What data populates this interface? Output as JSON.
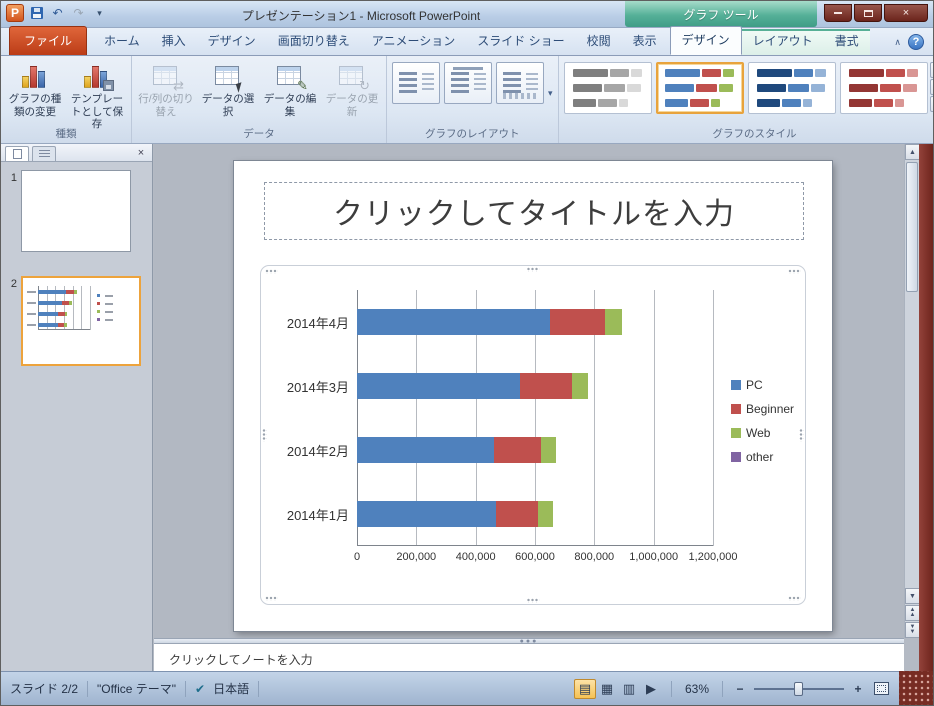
{
  "titlebar": {
    "title": "プレゼンテーション1 - Microsoft PowerPoint",
    "context_group": "グラフ ツール"
  },
  "icons": {
    "undo": "↶",
    "redo": "↷",
    "dropdown": "▾",
    "close": "×",
    "help": "?",
    "collapse": "∧",
    "scroll_up": "▲",
    "scroll_down": "▼",
    "panel_close": "×",
    "check": "✔",
    "switch": "⇄",
    "edit": "✎",
    "refresh": "↻",
    "view_normal": "▤",
    "view_sorter": "▦",
    "view_reading": "▥",
    "view_slideshow": "▶",
    "zoom_minus": "−",
    "zoom_plus": "+",
    "splitter_dots": "●●●"
  },
  "ribbon": {
    "file_tab": "ファイル",
    "tabs": [
      "ホーム",
      "挿入",
      "デザイン",
      "画面切り替え",
      "アニメーション",
      "スライド ショー",
      "校閲",
      "表示"
    ],
    "context_tabs": [
      "デザイン",
      "レイアウト",
      "書式"
    ],
    "groups": {
      "type": {
        "label": "種類",
        "buttons": [
          {
            "label": "グラフの種類の変更"
          },
          {
            "label": "テンプレートとして保存"
          }
        ]
      },
      "data": {
        "label": "データ",
        "buttons": [
          {
            "label": "行/列の切り替え",
            "disabled": true
          },
          {
            "label": "データの選択"
          },
          {
            "label": "データの編集"
          },
          {
            "label": "データの更新",
            "disabled": true
          }
        ]
      },
      "layouts": {
        "label": "グラフのレイアウト"
      },
      "styles": {
        "label": "グラフのスタイル",
        "gallery": [
          {
            "name": "style-gray",
            "colors": [
              "#7f7f7f",
              "#a6a6a6",
              "#d9d9d9"
            ]
          },
          {
            "name": "style-multicolor",
            "colors": [
              "#4f81bd",
              "#c0504d",
              "#9bbb59"
            ],
            "selected": true
          },
          {
            "name": "style-blue",
            "colors": [
              "#1f497d",
              "#4f81bd",
              "#95b3d7"
            ]
          },
          {
            "name": "style-red",
            "colors": [
              "#943634",
              "#c0504d",
              "#d99694"
            ]
          }
        ]
      }
    }
  },
  "slides_panel": {
    "slides": [
      {
        "number": "1"
      },
      {
        "number": "2",
        "selected": true
      }
    ]
  },
  "slide": {
    "title_placeholder": "クリックしてタイトルを入力"
  },
  "notes": {
    "placeholder": "クリックしてノートを入力"
  },
  "statusbar": {
    "slide_indicator": "スライド 2/2",
    "theme_name": "\"Office テーマ\"",
    "language": "日本語",
    "zoom_level": "63%"
  },
  "chart_data": {
    "type": "bar",
    "orientation": "horizontal",
    "stacked": true,
    "categories": [
      "2014年4月",
      "2014年3月",
      "2014年2月",
      "2014年1月"
    ],
    "series": [
      {
        "name": "PC",
        "color": "#4f81bd",
        "values": [
          650000,
          550000,
          460000,
          470000
        ]
      },
      {
        "name": "Beginner",
        "color": "#c0504d",
        "values": [
          185000,
          175000,
          160000,
          140000
        ]
      },
      {
        "name": "Web",
        "color": "#9bbb59",
        "values": [
          60000,
          55000,
          50000,
          50000
        ]
      },
      {
        "name": "other",
        "color": "#8064a2",
        "values": [
          0,
          0,
          0,
          0
        ]
      }
    ],
    "xlim": [
      0,
      1200000
    ],
    "xticks": [
      0,
      200000,
      400000,
      600000,
      800000,
      1000000,
      1200000
    ],
    "xtick_labels": [
      "0",
      "200,000",
      "400,000",
      "600,000",
      "800,000",
      "1,000,000",
      "1,200,000"
    ],
    "grid": true,
    "legend_position": "right",
    "title": "",
    "xlabel": "",
    "ylabel": ""
  }
}
